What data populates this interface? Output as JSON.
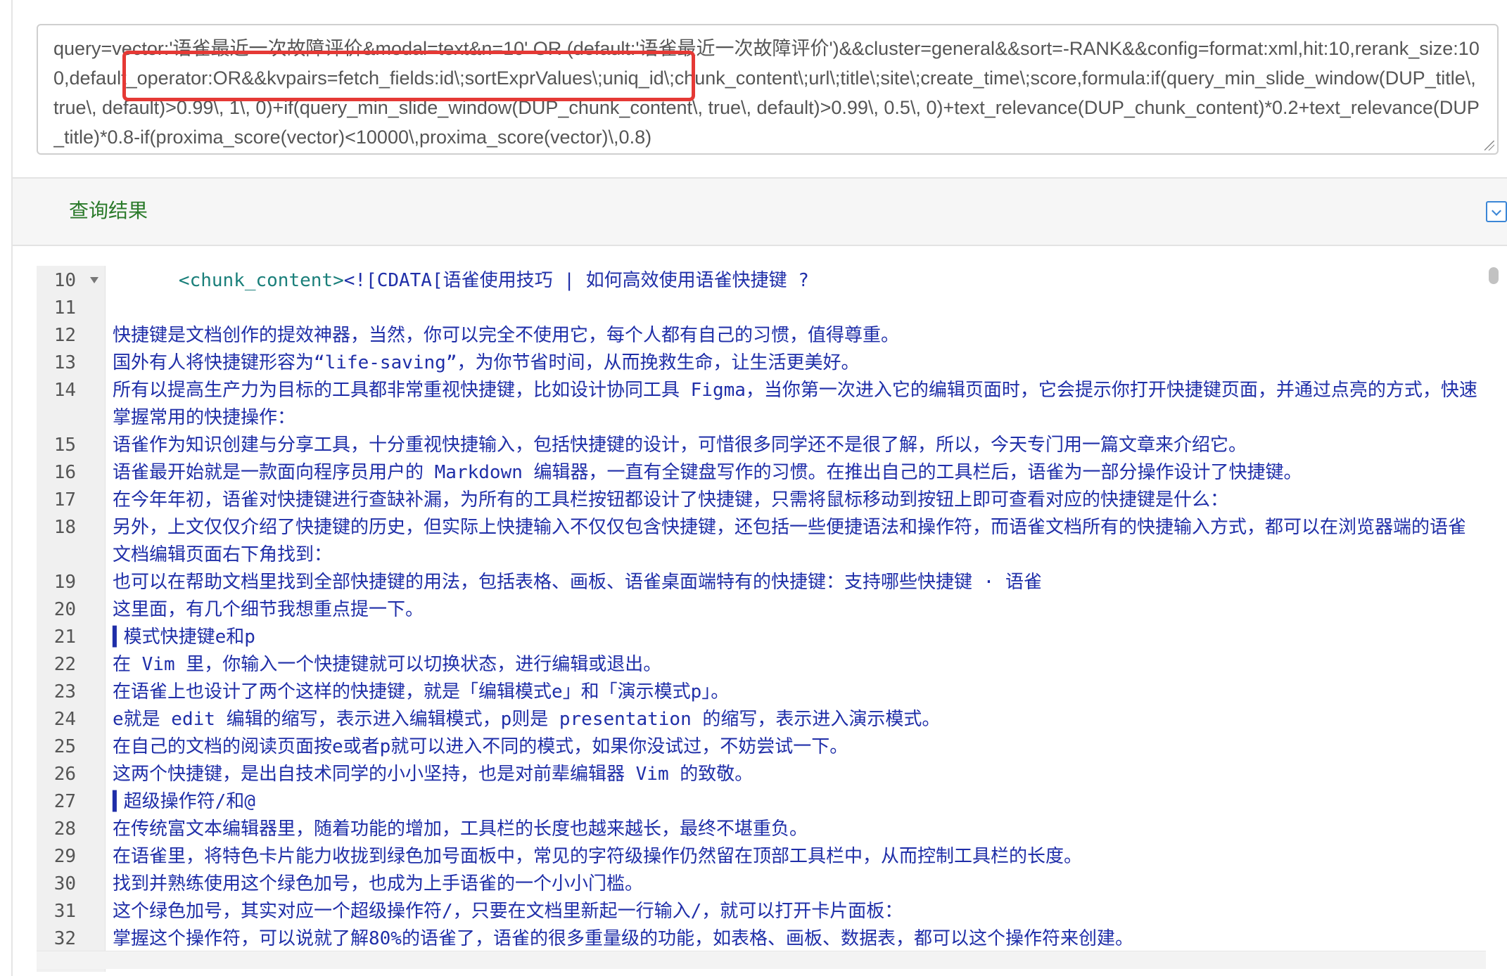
{
  "query": {
    "text": "query=vector:'语雀最近一次故障评价&modal=text&n=10' OR (default:'语雀最近一次故障评价')&&cluster=general&&sort=-RANK&&config=format:xml,hit:10,rerank_size:100,default_operator:OR&&kvpairs=fetch_fields:id\\;sortExprValues\\;uniq_id\\;chunk_content\\;url\\;title\\;site\\;create_time\\;score,formula:if(query_min_slide_window(DUP_title\\, true\\, default)>0.99\\, 1\\, 0)+if(query_min_slide_window(DUP_chunk_content\\, true\\, default)>0.99\\, 0.5\\, 0)+text_relevance(DUP_chunk_content)*0.2+text_relevance(DUP_title)*0.8-if(proxima_score(vector)<10000\\,proxima_score(vector)\\,0.8)",
    "highlight_color": "#e53935"
  },
  "results": {
    "title": "查询结果",
    "toggle_icon": "chevron-down-icon"
  },
  "editor": {
    "lines": [
      {
        "n": "10",
        "fold": true,
        "tag": "      <chunk_content>",
        "text": "<![CDATA[语雀使用技巧 | 如何高效使用语雀快捷键 ?"
      },
      {
        "n": "11",
        "text": ""
      },
      {
        "n": "12",
        "text": "快捷键是文档创作的提效神器，当然，你可以完全不使用它，每个人都有自己的习惯，值得尊重。"
      },
      {
        "n": "13",
        "text": "国外有人将快捷键形容为“life-saving”，为你节省时间，从而挽救生命，让生活更美好。"
      },
      {
        "n": "14",
        "text": "所有以提高生产力为目标的工具都非常重视快捷键，比如设计协同工具 Figma，当你第一次进入它的编辑页面时，它会提示你打开快捷键页面，并通过点亮的方式，快速掌握常用的快捷操作："
      },
      {
        "n": "15",
        "text": "语雀作为知识创建与分享工具，十分重视快捷输入，包括快捷键的设计，可惜很多同学还不是很了解，所以，今天专门用一篇文章来介绍它。"
      },
      {
        "n": "16",
        "text": "语雀最开始就是一款面向程序员用户的 Markdown 编辑器，一直有全键盘写作的习惯。在推出自己的工具栏后，语雀为一部分操作设计了快捷键。"
      },
      {
        "n": "17",
        "text": "在今年年初，语雀对快捷键进行查缺补漏，为所有的工具栏按钮都设计了快捷键，只需将鼠标移动到按钮上即可查看对应的快捷键是什么："
      },
      {
        "n": "18",
        "text": "另外，上文仅仅介绍了快捷键的历史，但实际上快捷输入不仅仅包含快捷键，还包括一些便捷语法和操作符，而语雀文档所有的快捷输入方式，都可以在浏览器端的语雀文档编辑页面右下角找到："
      },
      {
        "n": "19",
        "text": "也可以在帮助文档里找到全部快捷键的用法，包括表格、画板、语雀桌面端特有的快捷键：支持哪些快捷键 · 语雀"
      },
      {
        "n": "20",
        "text": "这里面，有几个细节我想重点提一下。"
      },
      {
        "n": "21",
        "text": "▍模式快捷键e和p"
      },
      {
        "n": "22",
        "text": "在 Vim 里，你输入一个快捷键就可以切换状态，进行编辑或退出。"
      },
      {
        "n": "23",
        "text": "在语雀上也设计了两个这样的快捷键，就是「编辑模式e」和「演示模式p」。"
      },
      {
        "n": "24",
        "text": "e就是 edit 编辑的缩写，表示进入编辑模式，p则是 presentation 的缩写，表示进入演示模式。"
      },
      {
        "n": "25",
        "text": "在自己的文档的阅读页面按e或者p就可以进入不同的模式，如果你没试过，不妨尝试一下。"
      },
      {
        "n": "26",
        "text": "这两个快捷键，是出自技术同学的小小坚持，也是对前辈编辑器 Vim 的致敬。"
      },
      {
        "n": "27",
        "text": "▍超级操作符/和@"
      },
      {
        "n": "28",
        "text": "在传统富文本编辑器里，随着功能的增加，工具栏的长度也越来越长，最终不堪重负。"
      },
      {
        "n": "29",
        "text": "在语雀里，将特色卡片能力收拢到绿色加号面板中，常见的字符级操作仍然留在顶部工具栏中，从而控制工具栏的长度。"
      },
      {
        "n": "30",
        "text": "找到并熟练使用这个绿色加号，也成为上手语雀的一个小小门槛。"
      },
      {
        "n": "31",
        "text": "这个绿色加号，其实对应一个超级操作符/，只要在文档里新起一行输入/，就可以打开卡片面板："
      },
      {
        "n": "32",
        "text": "掌握这个操作符，可以说就了解80%的语雀了，语雀的很多重量级的功能，如表格、画板、数据表，都可以这个操作符来创建。"
      }
    ]
  }
}
